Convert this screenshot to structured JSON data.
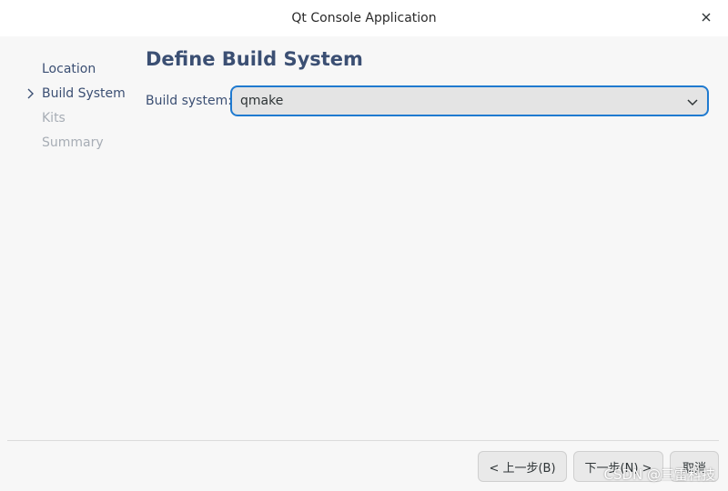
{
  "window": {
    "title": "Qt Console Application"
  },
  "sidebar": {
    "items": [
      {
        "label": "Location",
        "state": "done"
      },
      {
        "label": "Build System",
        "state": "current"
      },
      {
        "label": "Kits",
        "state": "pending"
      },
      {
        "label": "Summary",
        "state": "pending"
      }
    ]
  },
  "main": {
    "heading": "Define Build System",
    "build_system_label": "Build system:",
    "build_system_value": "qmake"
  },
  "footer": {
    "back_label": "< 上一步(B)",
    "next_label": "下一步(N) >",
    "cancel_label": "取消"
  },
  "watermark": "CSDN @三雷科技",
  "colors": {
    "accent": "#1f7ad0",
    "heading": "#3b4f73",
    "muted": "#a7adb5"
  }
}
